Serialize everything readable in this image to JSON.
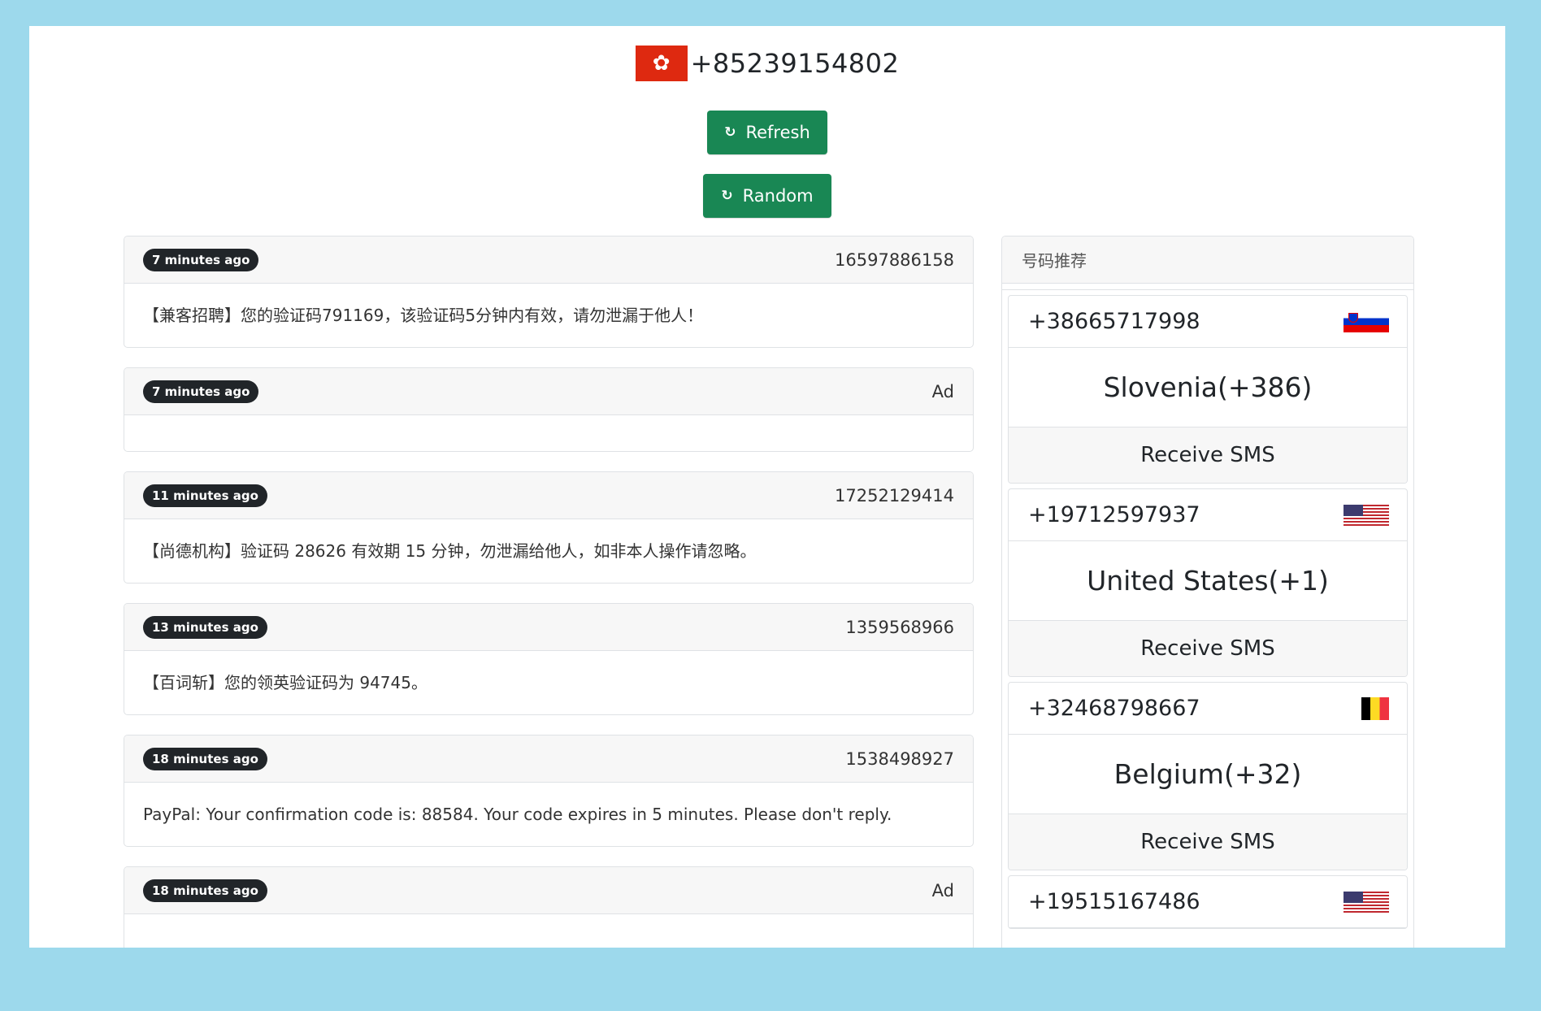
{
  "header": {
    "flag_symbol": "✿",
    "phone": "+85239154802"
  },
  "buttons": {
    "refresh_icon": "↻",
    "refresh_label": "Refresh",
    "random_icon": "↻",
    "random_label": "Random"
  },
  "messages": [
    {
      "time": "7 minutes ago",
      "sender": "16597886158",
      "text": "【兼客招聘】您的验证码791169，该验证码5分钟内有效，请勿泄漏于他人！"
    },
    {
      "time": "7 minutes ago",
      "sender": "Ad",
      "text": ""
    },
    {
      "time": "11 minutes ago",
      "sender": "17252129414",
      "text": "【尚德机构】验证码 28626 有效期 15 分钟，勿泄漏给他人，如非本人操作请忽略。"
    },
    {
      "time": "13 minutes ago",
      "sender": "1359568966",
      "text": "【百词斩】您的领英验证码为 94745。"
    },
    {
      "time": "18 minutes ago",
      "sender": "1538498927",
      "text": "PayPal: Your confirmation code is: 88584. Your code expires in 5 minutes. Please don't reply."
    },
    {
      "time": "18 minutes ago",
      "sender": "Ad",
      "text": ""
    }
  ],
  "sidebar": {
    "title": "号码推荐",
    "numbers": [
      {
        "phone": "+38665717998",
        "flag": "slovenia-flag",
        "country": "Slovenia(+386)",
        "action": "Receive SMS"
      },
      {
        "phone": "+19712597937",
        "flag": "united-states-flag",
        "country": "United States(+1)",
        "action": "Receive SMS"
      },
      {
        "phone": "+32468798667",
        "flag": "belgium-flag",
        "country": "Belgium(+32)",
        "action": "Receive SMS"
      },
      {
        "phone": "+19515167486",
        "flag": "united-states-flag",
        "country": "",
        "action": ""
      }
    ]
  }
}
